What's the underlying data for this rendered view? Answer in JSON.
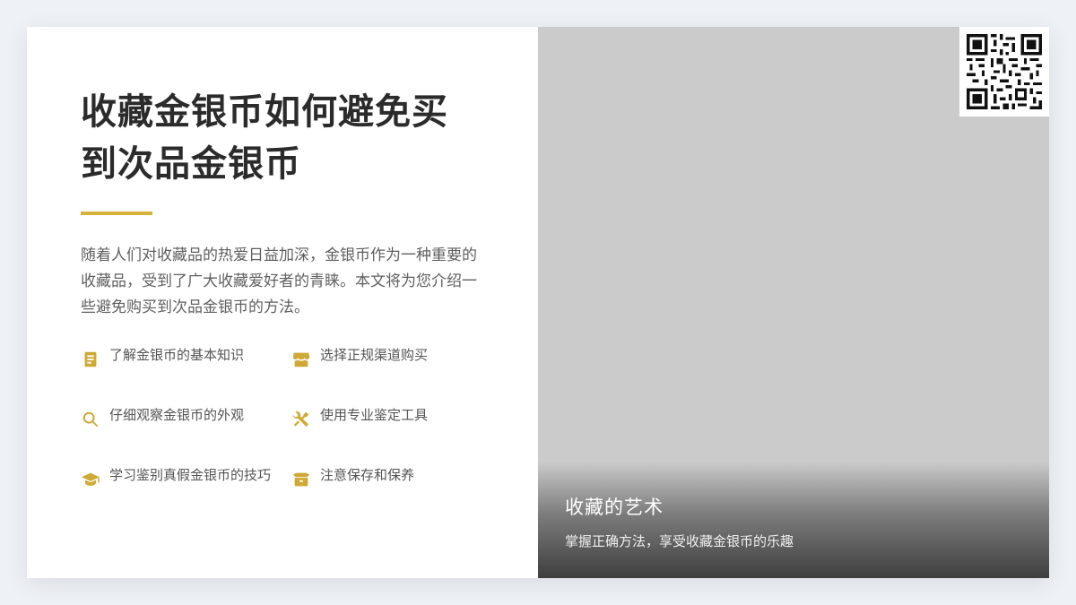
{
  "article": {
    "title": "收藏金银币如何避免买到次品金银币",
    "description": "随着人们对收藏品的热爱日益加深，金银币作为一种重要的收藏品，受到了广大收藏爱好者的青睐。本文将为您介绍一些避免购买到次品金银币的方法。",
    "accent_color": "#d4b23c"
  },
  "features": [
    {
      "icon": "book-icon",
      "label": "了解金银币的基本知识"
    },
    {
      "icon": "store-icon",
      "label": "选择正规渠道购买"
    },
    {
      "icon": "search-icon",
      "label": "仔细观察金银币的外观"
    },
    {
      "icon": "tools-icon",
      "label": "使用专业鉴定工具"
    },
    {
      "icon": "graduation-cap-icon",
      "label": "学习鉴别真假金银币的技巧"
    },
    {
      "icon": "box-icon",
      "label": "注意保存和保养"
    }
  ],
  "image_panel": {
    "caption_title": "收藏的艺术",
    "caption_subtitle": "掌握正确方法，享受收藏金银币的乐趣"
  }
}
